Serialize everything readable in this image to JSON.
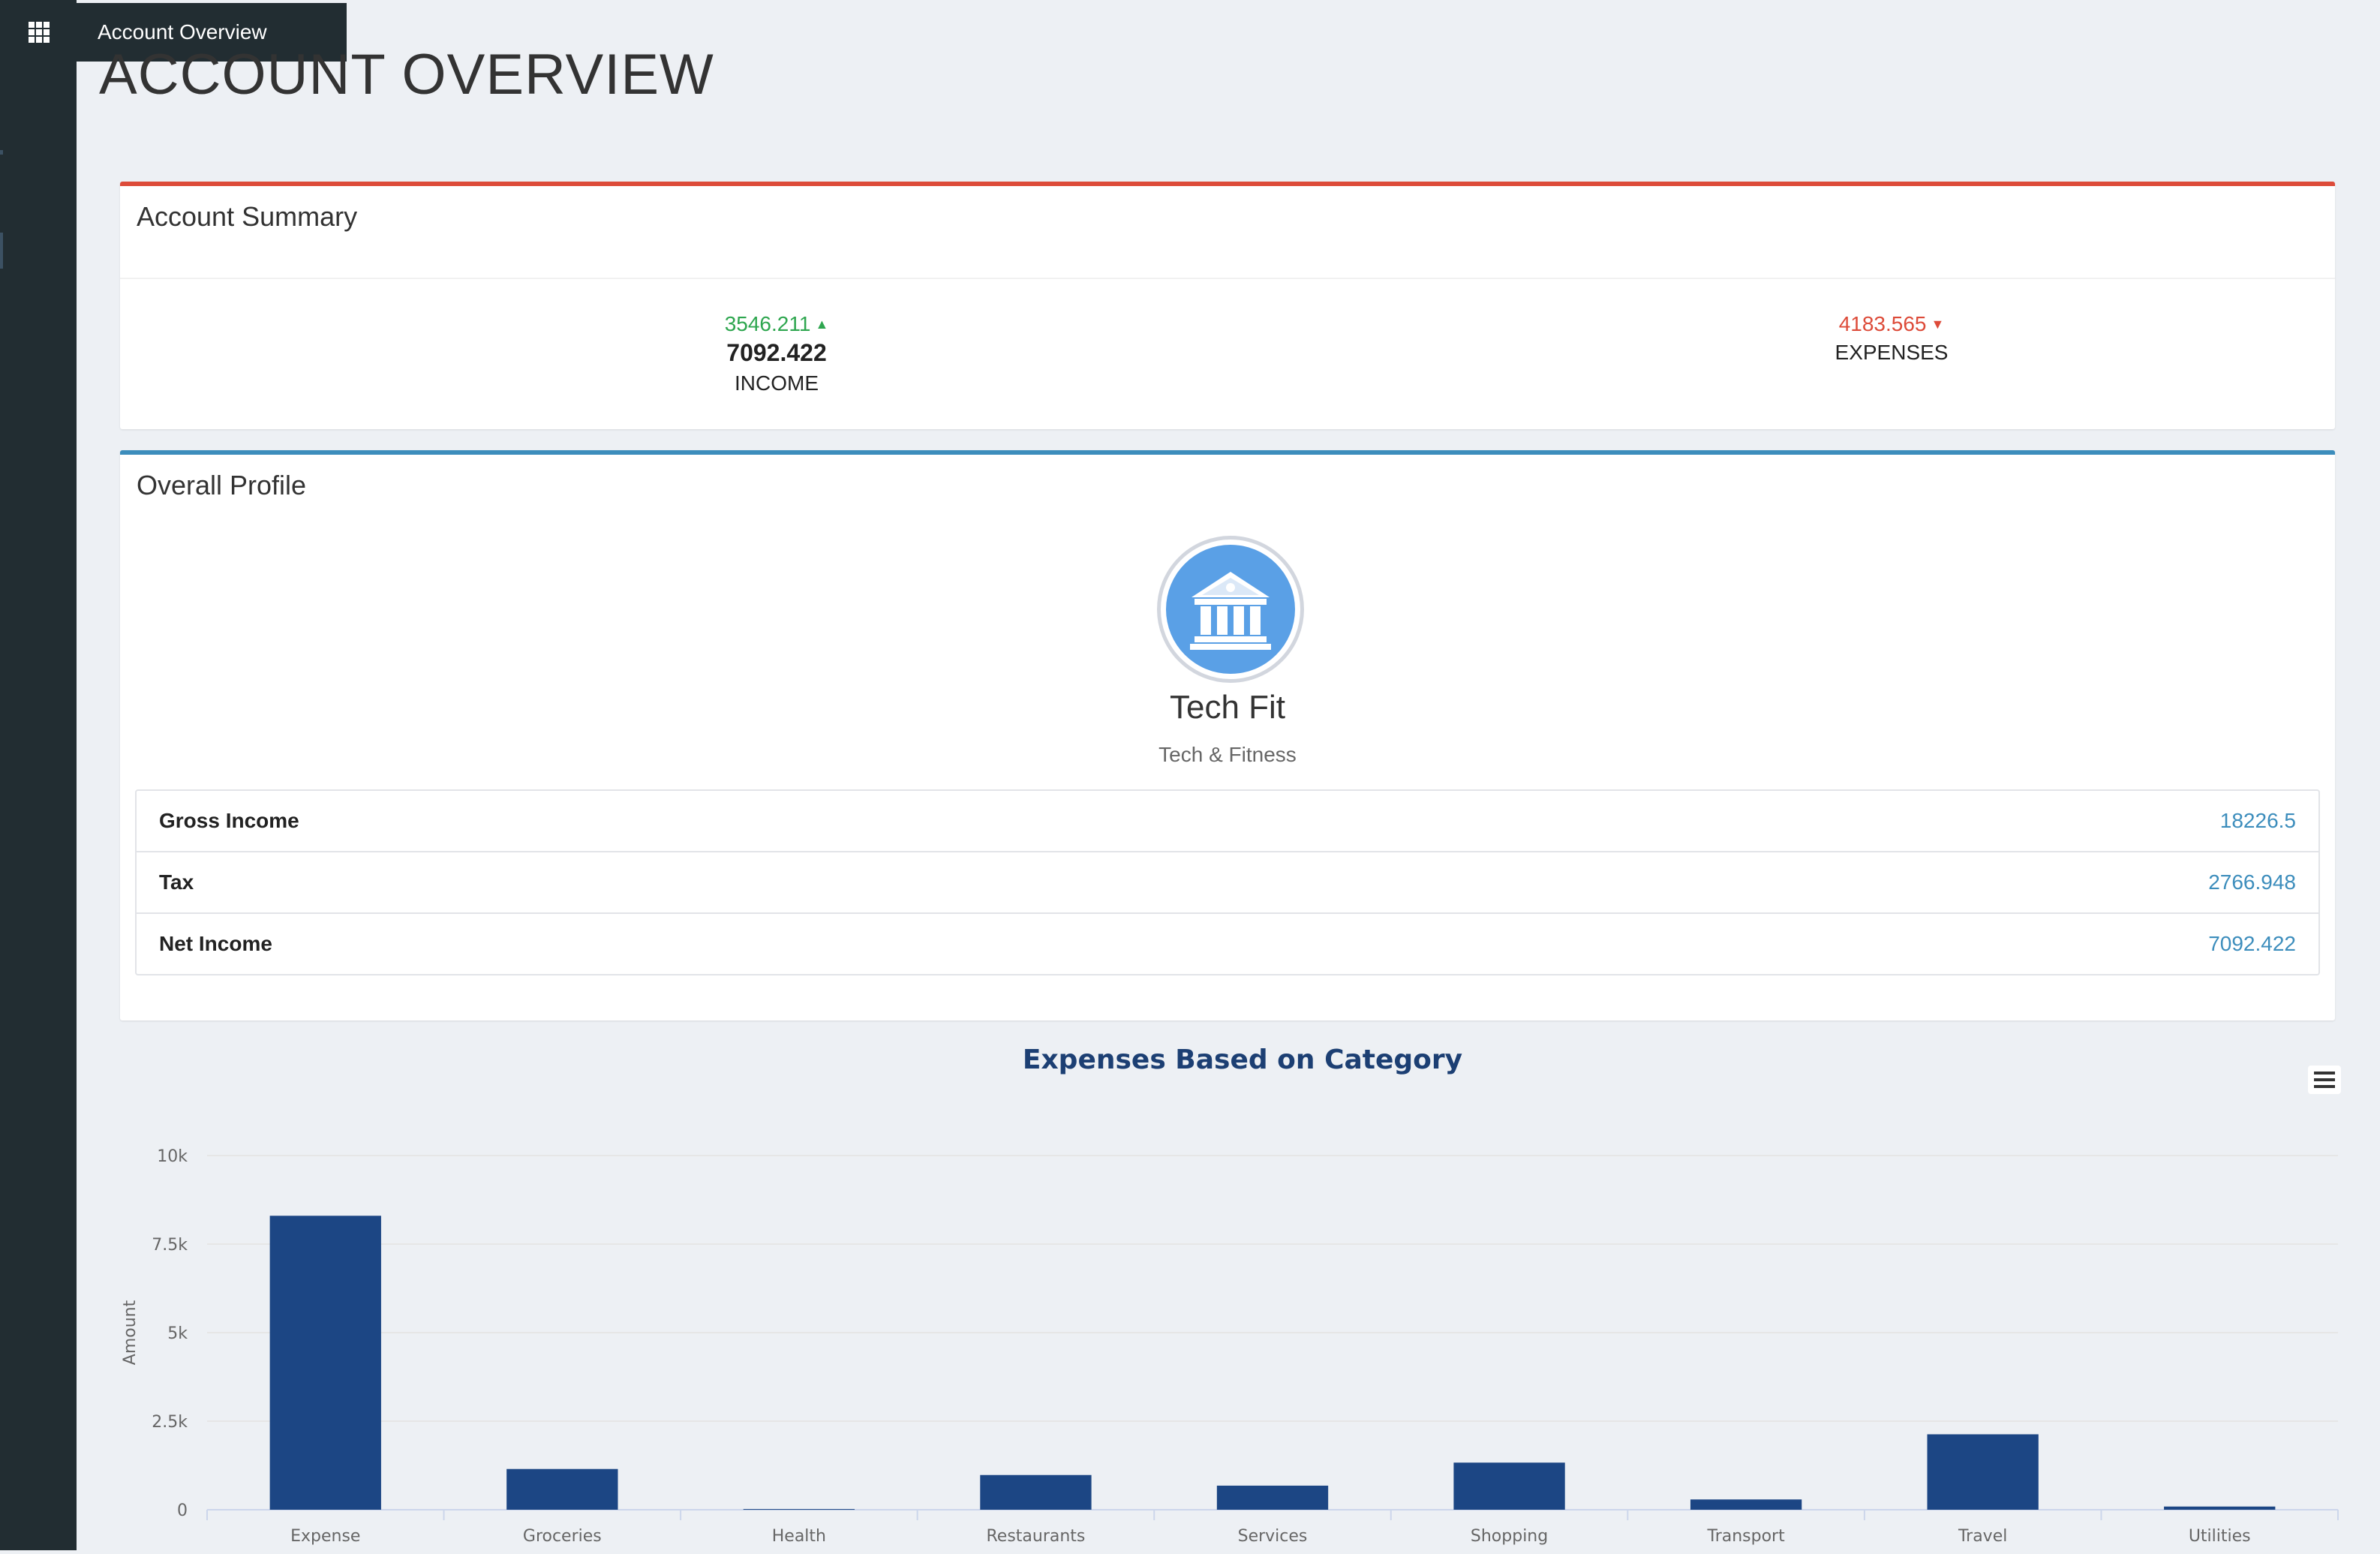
{
  "topbar": {
    "title": "Account Overview",
    "menu_icon": "apps-grid-icon"
  },
  "page": {
    "title": "ACCOUNT OVERVIEW"
  },
  "summary": {
    "title": "Account Summary",
    "income": {
      "delta": "3546.211",
      "amount": "7092.422",
      "label": "INCOME"
    },
    "expenses": {
      "delta": "4183.565",
      "label": "EXPENSES"
    }
  },
  "profile": {
    "title": "Overall Profile",
    "icon": "bank-icon",
    "name": "Tech Fit",
    "subtitle": "Tech & Fitness",
    "rows": [
      {
        "label": "Gross Income",
        "value": "18226.5"
      },
      {
        "label": "Tax",
        "value": "2766.948"
      },
      {
        "label": "Net Income",
        "value": "7092.422"
      }
    ]
  },
  "colors": {
    "up": "#2ea64f",
    "down": "#dd4b39",
    "accent_blue": "#3c8dbc",
    "bar": "#1c4684",
    "title": "#1c3f73"
  },
  "chart_data": {
    "type": "bar",
    "title": "Expenses Based on Category",
    "xlabel": "",
    "ylabel": "Amount",
    "categories": [
      "Expense",
      "Groceries",
      "Health",
      "Restaurants",
      "Services",
      "Shopping",
      "Transport",
      "Travel",
      "Utilities"
    ],
    "values": [
      8300,
      1150,
      20,
      980,
      680,
      1330,
      290,
      2130,
      90
    ],
    "ylim": [
      0,
      10000
    ],
    "yticks": [
      0,
      2500,
      5000,
      7500,
      10000
    ],
    "ytick_labels": [
      "0",
      "2.5k",
      "5k",
      "7.5k",
      "10k"
    ],
    "grid": true,
    "legend": false
  }
}
